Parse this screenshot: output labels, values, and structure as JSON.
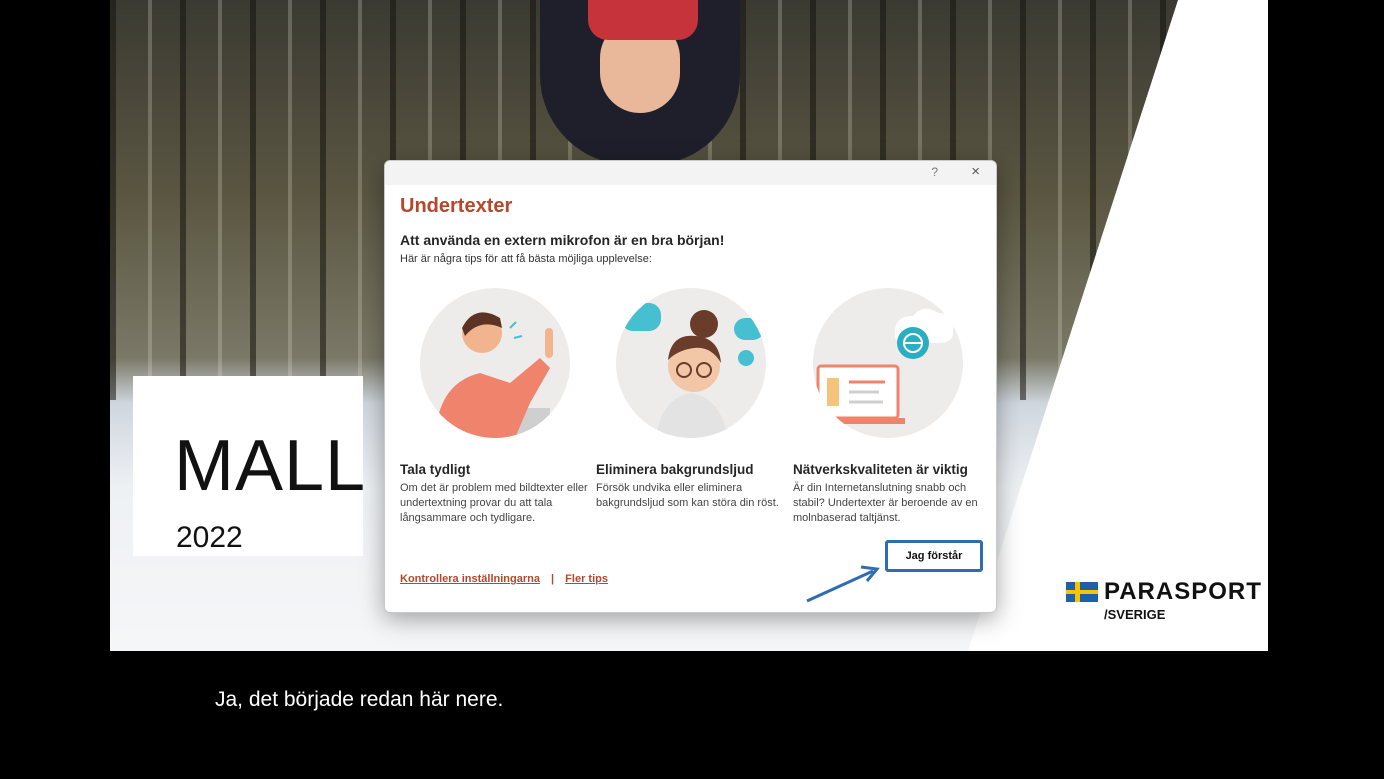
{
  "slide": {
    "title": "MALL",
    "year": "2022",
    "logo_text": "PARASPORT",
    "logo_sub": "/SVERIGE"
  },
  "dialog": {
    "help_icon": "?",
    "close_icon": "×",
    "title": "Undertexter",
    "heading": "Att använda en extern mikrofon är en bra början!",
    "subheading": "Här är några tips för att få bästa möjliga upplevelse:",
    "tips": [
      {
        "title": "Tala tydligt",
        "text": "Om det är problem med bildtexter eller undertextning provar du att tala långsammare och tydligare.",
        "icon": "speaking-person-icon"
      },
      {
        "title": "Eliminera bakgrundsljud",
        "text": "Försök undvika eller eliminera bakgrundsljud som kan störa din röst.",
        "icon": "quiet-person-icon"
      },
      {
        "title": "Nätverkskvaliteten är viktig",
        "text": "Är din Internetanslutning snabb och stabil? Undertexter är beroende av en molnbaserad taltjänst.",
        "icon": "cloud-laptop-icon"
      }
    ],
    "ok_button": "Jag förstår",
    "link_settings": "Kontrollera inställningarna",
    "link_separator": "|",
    "link_more": "Fler tips"
  },
  "caption": "Ja, det började redan här nere."
}
